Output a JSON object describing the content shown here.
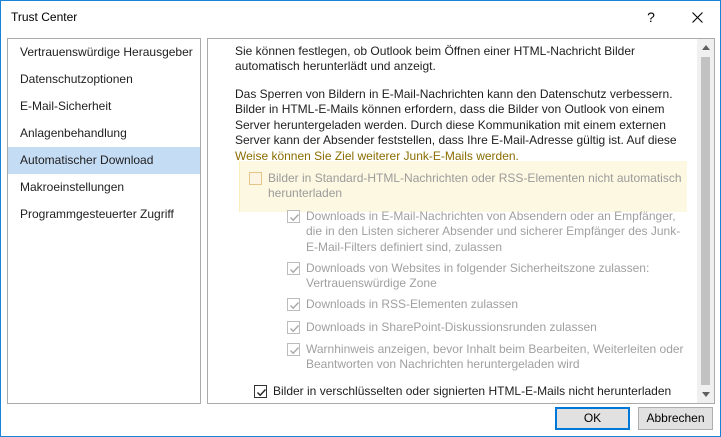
{
  "window": {
    "title": "Trust Center",
    "help_label": "?"
  },
  "nav": {
    "items": [
      {
        "label": "Vertrauenswürdige Herausgeber"
      },
      {
        "label": "Datenschutzoptionen"
      },
      {
        "label": "E-Mail-Sicherheit"
      },
      {
        "label": "Anlagenbehandlung"
      },
      {
        "label": "Automatischer Download"
      },
      {
        "label": "Makroeinstellungen"
      },
      {
        "label": "Programmgesteuerter Zugriff"
      }
    ],
    "selected_index": 4
  },
  "content": {
    "intro": "Sie können festlegen, ob Outlook beim Öffnen einer HTML-Nachricht Bilder automatisch herunterlädt und anzeigt.",
    "explain_main": "Das Sperren von Bildern in E-Mail-Nachrichten kann den Datenschutz verbessern. Bilder in HTML-E-Mails können erfordern, dass die Bilder von Outlook von einem Server heruntergeladen werden. Durch diese Kommunikation mit einem externen Server kann der Absender feststellen, dass Ihre E-Mail-Adresse gültig ist. Auf diese",
    "explain_last": "Weise können Sie Ziel weiterer Junk-E-Mails werden.",
    "options": [
      {
        "label": "Bilder in Standard-HTML-Nachrichten oder RSS-Elementen nicht automatisch herunterladen",
        "checked": false
      },
      {
        "label": "Downloads in E-Mail-Nachrichten von Absendern oder an Empfänger, die in den Listen sicherer Absender und sicherer Empfänger des Junk-E-Mail-Filters definiert sind, zulassen",
        "checked": true
      },
      {
        "label": "Downloads von Websites in folgender Sicherheitszone zulassen: Vertrauenswürdige Zone",
        "checked": true
      },
      {
        "label": "Downloads in RSS-Elementen zulassen",
        "checked": true
      },
      {
        "label": "Downloads in SharePoint-Diskussionsrunden zulassen",
        "checked": true
      },
      {
        "label": "Warnhinweis anzeigen, bevor Inhalt beim Bearbeiten, Weiterleiten oder Beantworten von Nachrichten heruntergeladen wird",
        "checked": true
      },
      {
        "label": "Bilder in verschlüsselten oder signierten HTML-E-Mails nicht herunterladen",
        "checked": true
      }
    ]
  },
  "buttons": {
    "ok": "OK",
    "cancel": "Abbrechen"
  },
  "colors": {
    "selection": "#c5dcf5",
    "accent_border": "#1883d7",
    "highlight_bg": "#fdf8e1",
    "disabled_text": "#a0a0a0"
  }
}
